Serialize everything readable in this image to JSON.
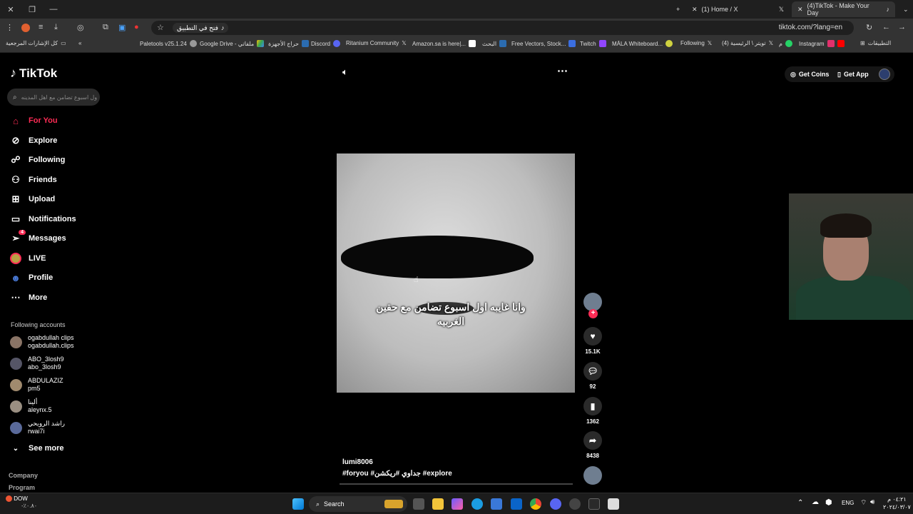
{
  "browser": {
    "tabs": [
      {
        "label": "(1) Home / X"
      },
      {
        "label": "(4)TikTok - Make Your Day"
      }
    ],
    "address": "tiktok.com/?lang=en",
    "open_in_app": "فتح في التطبيق",
    "bookmarks": [
      {
        "label": "كل الإشارات المرجعية"
      },
      {
        "label": "Paletools v25.1.24"
      },
      {
        "label": "Google Drive - ملفاتي"
      },
      {
        "label": "حراج الأجهزة"
      },
      {
        "label": "Discord"
      },
      {
        "label": "Ritanium Community"
      },
      {
        "label": "Amazon.sa is here|..."
      },
      {
        "label": "البحث"
      },
      {
        "label": "Free Vectors, Stock..."
      },
      {
        "label": "Twitch"
      },
      {
        "label": "MĀLA Whiteboard..."
      },
      {
        "label": "Following"
      },
      {
        "label": "(4) تويتر \\ الرئيسية"
      },
      {
        "label": "م"
      },
      {
        "label": "Instagram"
      },
      {
        "label": "التطبيقات"
      }
    ]
  },
  "tiktok": {
    "logo": "TikTok",
    "search_placeholder": "ول اسبوع تضامن مع اهل المدينه",
    "nav": [
      {
        "label": "For You",
        "icon": "home-icon"
      },
      {
        "label": "Explore",
        "icon": "compass-icon"
      },
      {
        "label": "Following",
        "icon": "following-icon"
      },
      {
        "label": "Friends",
        "icon": "friends-icon"
      },
      {
        "label": "Upload",
        "icon": "upload-icon"
      },
      {
        "label": "Notifications",
        "icon": "notifications-icon"
      },
      {
        "label": "Messages",
        "icon": "messages-icon",
        "badge": "4"
      },
      {
        "label": "LIVE",
        "icon": "live-icon"
      },
      {
        "label": "Profile",
        "icon": "profile-icon"
      },
      {
        "label": "More",
        "icon": "more-icon"
      }
    ],
    "following_title": "Following accounts",
    "accounts": [
      {
        "name": "ogabdullah clips",
        "handle": "ogabdullah.clips"
      },
      {
        "name": "ABO_3losh9",
        "handle": "abo_3losh9"
      },
      {
        "name": "ABDULAZIZ",
        "handle": "pm5"
      },
      {
        "name": "ألينا",
        "handle": "aleynx.5"
      },
      {
        "name": "راشد الرويحي",
        "handle": "rwai7i"
      }
    ],
    "see_more": "See more",
    "footer": [
      "Company",
      "Program"
    ],
    "get_coins": "Get Coins",
    "get_app": "Get App",
    "video": {
      "caption": "وانا غايبه اول اسبوع تضامن مع حقين الغربيه",
      "author": "lumi8006",
      "tags": "#foryou #جداوي #ريكشن #explore",
      "likes": "15.1K",
      "comments": "92",
      "saves": "1362",
      "shares": "8438"
    }
  },
  "taskbar": {
    "search": "Search",
    "lang": "ENG",
    "stock": "DOW",
    "stock_change": "-٪٠.٨٠",
    "time": "٠٤:٢١ م",
    "date": "٢٠٢٤/٠٣/٠٧"
  }
}
